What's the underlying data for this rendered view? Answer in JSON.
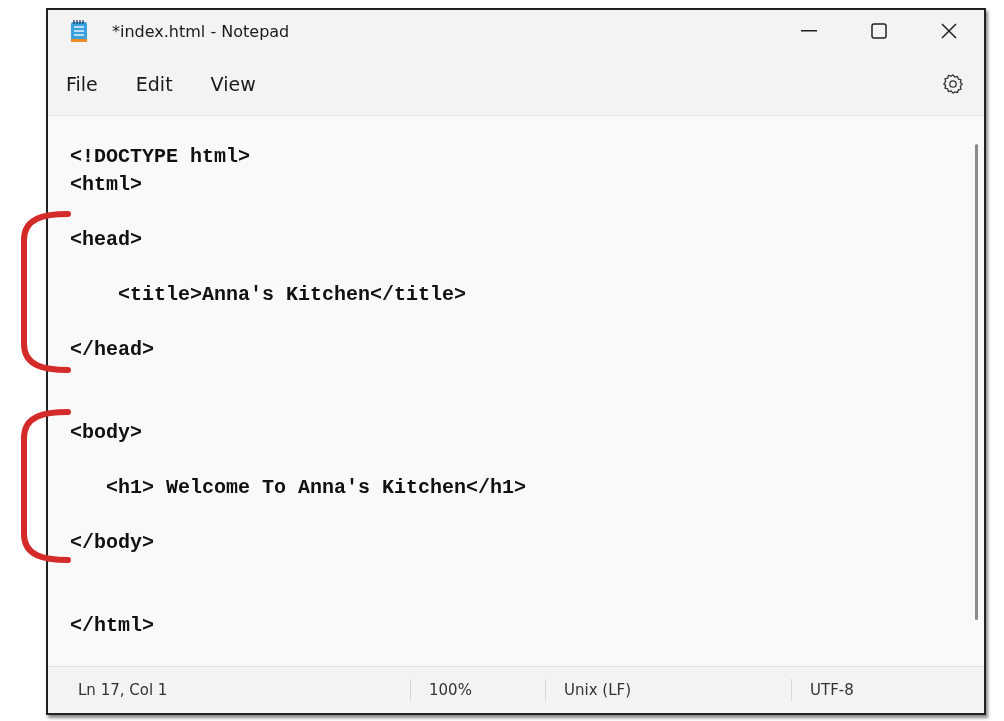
{
  "window": {
    "title": "*index.html - Notepad"
  },
  "menu": [
    {
      "label": "File"
    },
    {
      "label": "Edit"
    },
    {
      "label": "View"
    }
  ],
  "editor": {
    "lines": [
      {
        "kind": "text",
        "text": "<!DOCTYPE html>"
      },
      {
        "kind": "text",
        "text": "<html>"
      },
      {
        "kind": "blank"
      },
      {
        "kind": "text",
        "text": "<head>"
      },
      {
        "kind": "blank"
      },
      {
        "kind": "text",
        "text": "    <title>Anna's Kitchen</title>"
      },
      {
        "kind": "blank"
      },
      {
        "kind": "text",
        "text": "</head>"
      },
      {
        "kind": "blank"
      },
      {
        "kind": "blank"
      },
      {
        "kind": "text",
        "text": "<body>"
      },
      {
        "kind": "blank"
      },
      {
        "kind": "text",
        "text": "   <h1> Welcome To Anna's Kitchen</h1>"
      },
      {
        "kind": "blank"
      },
      {
        "kind": "text",
        "text": "</body>"
      },
      {
        "kind": "blank"
      },
      {
        "kind": "blank"
      },
      {
        "kind": "text",
        "text": "</html>"
      }
    ]
  },
  "annotations": [
    {
      "kind": "bracket",
      "color": "#d42a2a"
    },
    {
      "kind": "bracket",
      "color": "#d42a2a"
    }
  ],
  "status_bar": [
    {
      "text": "Ln 17, Col 1"
    },
    {
      "text": "100%"
    },
    {
      "text": "Unix (LF)"
    },
    {
      "text": "UTF-8"
    }
  ]
}
